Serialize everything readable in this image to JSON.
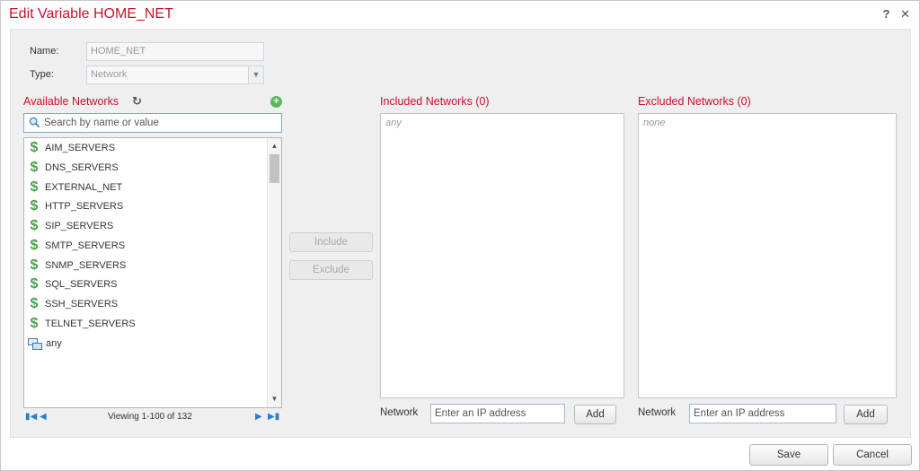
{
  "dialog": {
    "title": "Edit Variable HOME_NET",
    "help_symbol": "?",
    "close_symbol": "✕"
  },
  "form": {
    "name_label": "Name:",
    "name_value": "HOME_NET",
    "type_label": "Type:",
    "type_value": "Network"
  },
  "available": {
    "title": "Available Networks",
    "search_placeholder": "Search by name or value",
    "items": [
      {
        "label": "AIM_SERVERS",
        "icon": "dollar-variable-icon"
      },
      {
        "label": "DNS_SERVERS",
        "icon": "dollar-variable-icon"
      },
      {
        "label": "EXTERNAL_NET",
        "icon": "dollar-variable-icon"
      },
      {
        "label": "HTTP_SERVERS",
        "icon": "dollar-variable-icon"
      },
      {
        "label": "SIP_SERVERS",
        "icon": "dollar-variable-icon"
      },
      {
        "label": "SMTP_SERVERS",
        "icon": "dollar-variable-icon"
      },
      {
        "label": "SNMP_SERVERS",
        "icon": "dollar-variable-icon"
      },
      {
        "label": "SQL_SERVERS",
        "icon": "dollar-variable-icon"
      },
      {
        "label": "SSH_SERVERS",
        "icon": "dollar-variable-icon"
      },
      {
        "label": "TELNET_SERVERS",
        "icon": "dollar-variable-icon"
      },
      {
        "label": "any",
        "icon": "network-object-icon"
      }
    ],
    "pager_text": "Viewing 1-100 of 132"
  },
  "actions": {
    "include_label": "Include",
    "exclude_label": "Exclude"
  },
  "included": {
    "title": "Included Networks (0)",
    "empty_text": "any",
    "network_label": "Network",
    "ip_placeholder": "Enter an IP address",
    "add_label": "Add"
  },
  "excluded": {
    "title": "Excluded Networks (0)",
    "empty_text": "none",
    "network_label": "Network",
    "ip_placeholder": "Enter an IP address",
    "add_label": "Add"
  },
  "footer": {
    "save_label": "Save",
    "cancel_label": "Cancel"
  },
  "colors": {
    "accent_red": "#c8102e",
    "variable_green": "#4aa24a",
    "pager_blue": "#2b7bd1"
  }
}
